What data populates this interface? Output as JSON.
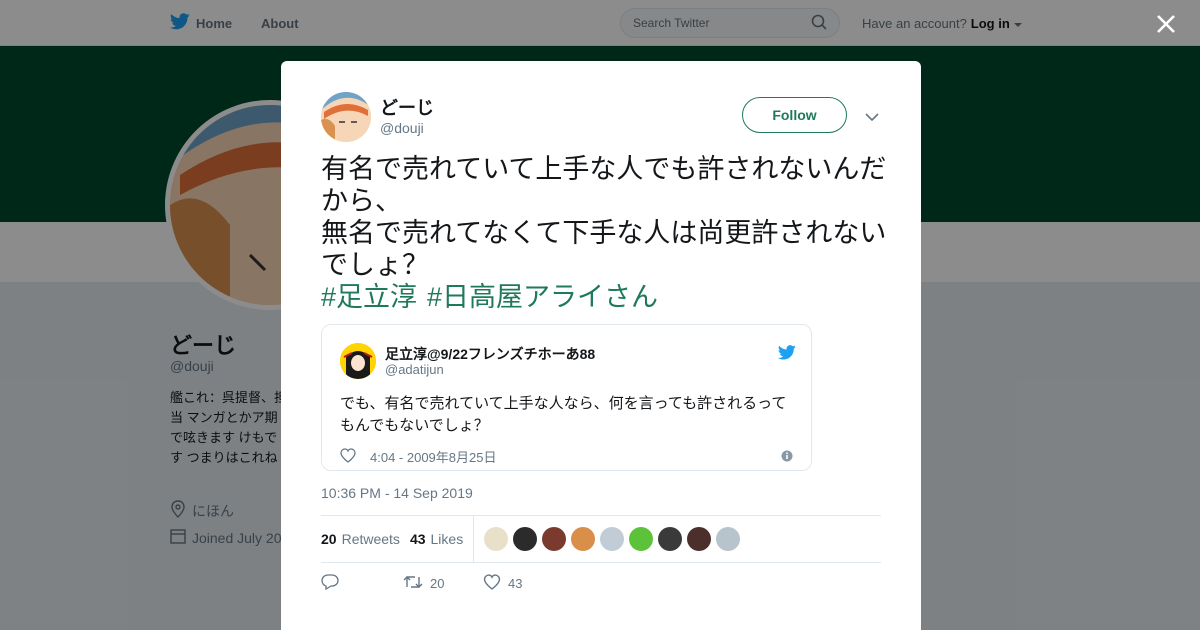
{
  "topbar": {
    "home_label": "Home",
    "about_label": "About",
    "search_placeholder": "Search Twitter",
    "have_account": "Have an account?",
    "login_label": "Log in"
  },
  "profile": {
    "name": "どーじ",
    "handle": "@douji",
    "bio": "艦これ：呉提督、担当 マンガとかア期で呟きます けもです つまりはこれね",
    "location": "にほん",
    "joined": "Joined July 20"
  },
  "tweet": {
    "author_name": "どーじ",
    "author_handle": "@douji",
    "follow_label": "Follow",
    "text": "有名で売れていて上手な人でも許されないんだから、\n無名で売れてなくて下手な人は尚更許されないでしょ？",
    "hashtags": [
      "#足立淳",
      "#日高屋アライさん"
    ],
    "timestamp": "10:36 PM - 14 Sep 2019",
    "retweets_count": "20",
    "retweets_label": "Retweets",
    "likes_count": "43",
    "likes_label": "Likes",
    "action_retweets": "20",
    "action_likes": "43"
  },
  "quoted": {
    "name": "足立淳@9/22フレンズチホーあ88",
    "handle": "@adatijun",
    "text": "でも、有名で売れていて上手な人なら、何を言っても許されるってもんでもないでしょ？",
    "timestamp": "4:04 - 2009年8月25日"
  },
  "colors": {
    "accent": "#1f7a5c",
    "banner": "#00492e",
    "twitter_blue": "#1da1f2"
  },
  "icons": [
    "bird-icon",
    "search-icon",
    "close-icon",
    "chevron-down-icon",
    "location-icon",
    "calendar-icon",
    "heart-icon",
    "info-icon",
    "reply-icon",
    "retweet-icon"
  ],
  "liker_face_colors": [
    "#e8e0c8",
    "#2b2b2b",
    "#7a3b2e",
    "#d98e4a",
    "#c2ccd6",
    "#5cc23a",
    "#3a3a3a",
    "#4a2f2a",
    "#b8c4cc"
  ]
}
